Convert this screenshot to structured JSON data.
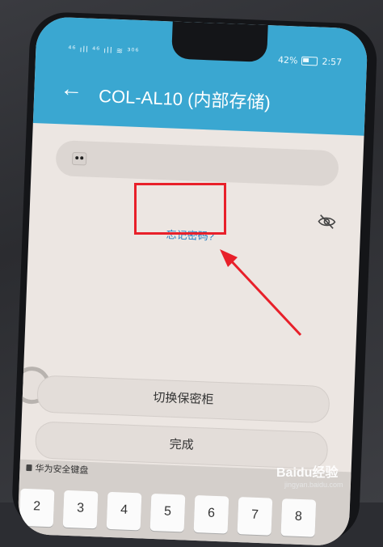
{
  "status": {
    "left": "⁴⁶ ıll ⁴⁶ ıll ≋ ³⁰⁶",
    "battery": "42%",
    "time": "2:57"
  },
  "header": {
    "back_icon": "←",
    "title": "COL-AL10 (内部存储)"
  },
  "password_field": {
    "value": "••"
  },
  "forgot_link": "忘记密码?",
  "buttons": {
    "switch": "切换保密柜",
    "done": "完成"
  },
  "keyboard": {
    "label": "华为安全键盘",
    "keys": [
      "2",
      "3",
      "4",
      "5",
      "6",
      "7",
      "8"
    ]
  },
  "watermark": {
    "text": "Baidu经验",
    "sub": "jingyan.baidu.com"
  },
  "annotation": {
    "box_color": "#e8202a",
    "arrow_color": "#e8202a"
  }
}
